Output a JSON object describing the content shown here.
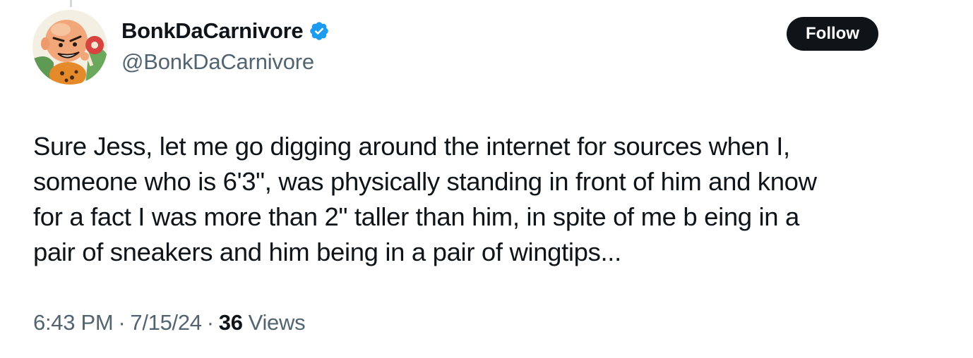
{
  "author": {
    "display_name": "BonkDaCarnivore",
    "handle": "@BonkDaCarnivore",
    "verified": true,
    "verified_color": "#1d9bf0"
  },
  "follow_button": {
    "label": "Follow",
    "background": "#0f1419"
  },
  "tweet": {
    "lines": [
      "Sure Jess, let me go digging around the internet for sources when I,",
      "someone who is 6'3\", was physically standing in front of him and know",
      "for a fact I was more than 2\" taller than him, in spite of me b eing in a",
      "pair of sneakers and him being in a pair of wingtips..."
    ]
  },
  "meta": {
    "time": "6:43 PM",
    "separator": "·",
    "date": "7/15/24",
    "views_count": "36",
    "views_label": "Views"
  },
  "icons": {
    "avatar": "cartoon-caveman-avatar",
    "verified": "verified-badge-icon"
  }
}
